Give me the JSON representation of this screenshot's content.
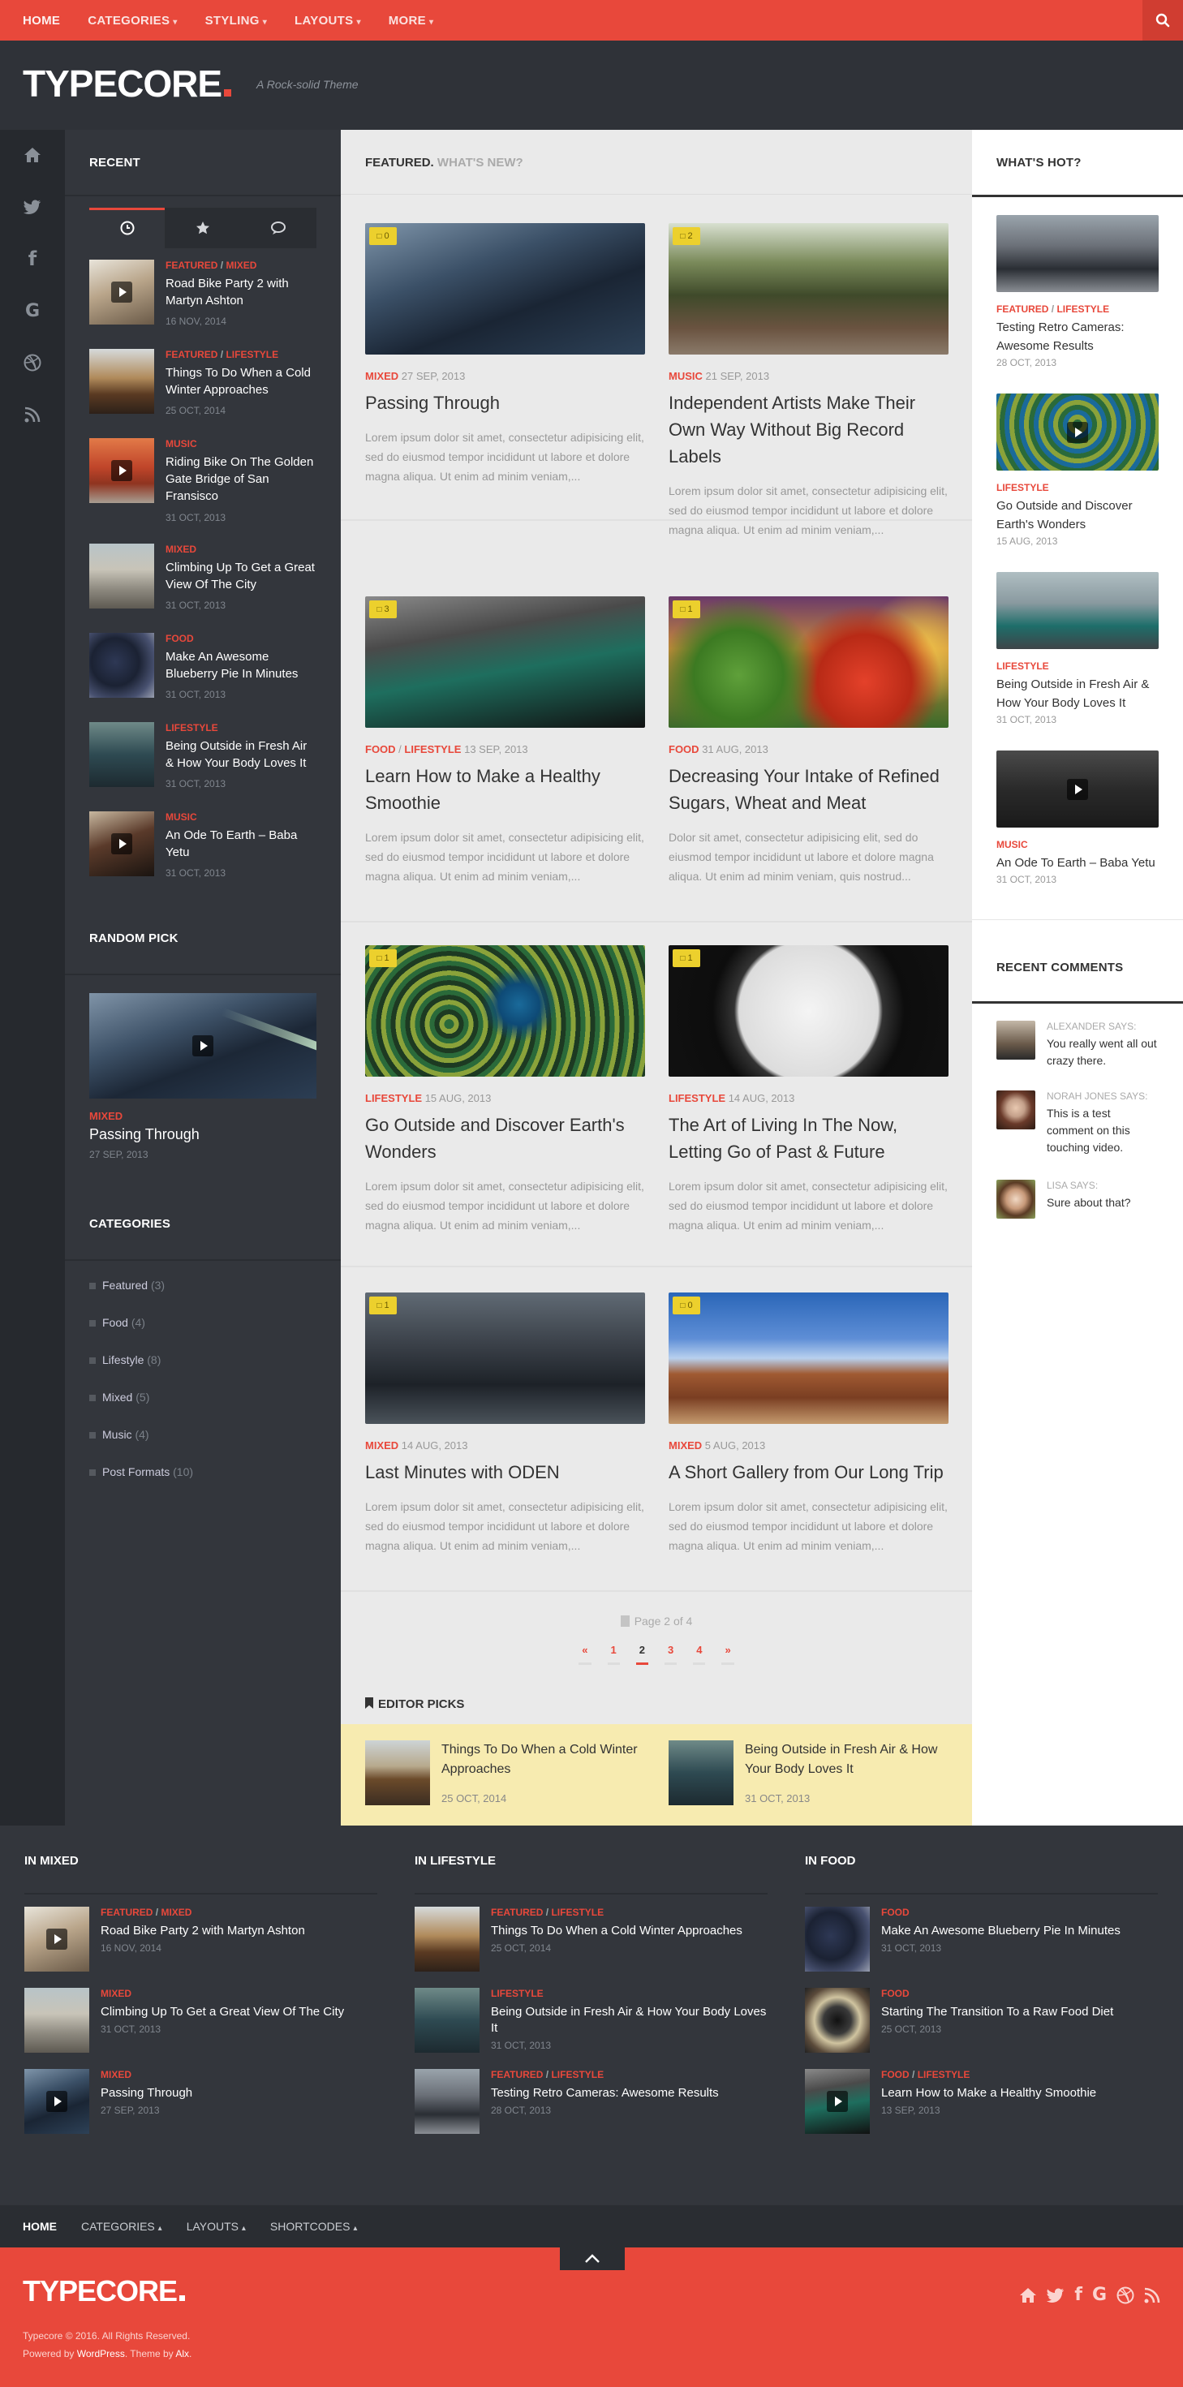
{
  "topnav": {
    "items": [
      {
        "label": "HOME",
        "caret": ""
      },
      {
        "label": "CATEGORIES",
        "caret": "▾"
      },
      {
        "label": "STYLING",
        "caret": "▾"
      },
      {
        "label": "LAYOUTS",
        "caret": "▾"
      },
      {
        "label": "MORE",
        "caret": "▾"
      }
    ],
    "search_icon": "search-icon",
    "accent": "#e8483b"
  },
  "header": {
    "logo": "TYPECORE",
    "tagline": "A Rock-solid Theme"
  },
  "iconbar": [
    "home-icon",
    "twitter-icon",
    "facebook-icon",
    "google-icon",
    "dribbble-icon",
    "rss-icon"
  ],
  "sidebar": {
    "recent_title": "RECENT",
    "tabs": [
      "clock-icon",
      "star-icon",
      "comments-icon"
    ],
    "recent": [
      {
        "cat1": "FEATURED",
        "cat2": "MIXED",
        "title": "Road Bike Party 2 with Martyn Ashton",
        "date": "16 NOV, 2014"
      },
      {
        "cat1": "FEATURED",
        "cat2": "LIFESTYLE",
        "title": "Things To Do When a Cold Winter Approaches",
        "date": "25 OCT, 2014"
      },
      {
        "cat1": "MUSIC",
        "cat2": "",
        "title": "Riding Bike On The Golden Gate Bridge of San Fransisco",
        "date": "31 OCT, 2013"
      },
      {
        "cat1": "MIXED",
        "cat2": "",
        "title": "Climbing Up To Get a Great View Of The City",
        "date": "31 OCT, 2013"
      },
      {
        "cat1": "FOOD",
        "cat2": "",
        "title": "Make An Awesome Blueberry Pie In Minutes",
        "date": "31 OCT, 2013"
      },
      {
        "cat1": "LIFESTYLE",
        "cat2": "",
        "title": "Being Outside in Fresh Air & How Your Body Loves It",
        "date": "31 OCT, 2013"
      },
      {
        "cat1": "MUSIC",
        "cat2": "",
        "title": "An Ode To Earth – Baba Yetu",
        "date": "31 OCT, 2013"
      }
    ],
    "random_title": "RANDOM PICK",
    "random": {
      "cat": "MIXED",
      "title": "Passing Through",
      "date": "27 SEP, 2013"
    },
    "categories_title": "CATEGORIES",
    "categories": [
      {
        "name": "Featured",
        "count": "(3)"
      },
      {
        "name": "Food",
        "count": "(4)"
      },
      {
        "name": "Lifestyle",
        "count": "(8)"
      },
      {
        "name": "Mixed",
        "count": "(5)"
      },
      {
        "name": "Music",
        "count": "(4)"
      },
      {
        "name": "Post Formats",
        "count": "(10)"
      }
    ]
  },
  "main": {
    "heading": "FEATURED.",
    "subheading": "WHAT'S NEW?",
    "posts": [
      {
        "comments": "0",
        "cat1": "MIXED",
        "cat2": "",
        "date": "27 SEP, 2013",
        "title": "Passing Through",
        "excerpt": "Lorem ipsum dolor sit amet, consectetur adipisicing elit, sed do eiusmod tempor incididunt ut labore et dolore magna aliqua. Ut enim ad minim veniam,..."
      },
      {
        "comments": "2",
        "cat1": "MUSIC",
        "cat2": "",
        "date": "21 SEP, 2013",
        "title": "Independent Artists Make Their Own Way Without Big Record Labels",
        "excerpt": "Lorem ipsum dolor sit amet, consectetur adipisicing elit, sed do eiusmod tempor incididunt ut labore et dolore magna aliqua. Ut enim ad minim veniam,..."
      },
      {
        "comments": "3",
        "cat1": "FOOD",
        "cat2": "LIFESTYLE",
        "date": "13 SEP, 2013",
        "title": "Learn How to Make a Healthy Smoothie",
        "excerpt": "Lorem ipsum dolor sit amet, consectetur adipisicing elit, sed do eiusmod tempor incididunt ut labore et dolore magna aliqua. Ut enim ad minim veniam,..."
      },
      {
        "comments": "1",
        "cat1": "FOOD",
        "cat2": "",
        "date": "31 AUG, 2013",
        "title": "Decreasing Your Intake of Refined Sugars, Wheat and Meat",
        "excerpt": "Dolor sit amet, consectetur adipisicing elit, sed do eiusmod tempor incididunt ut labore et dolore magna aliqua. Ut enim ad minim veniam, quis nostrud..."
      },
      {
        "comments": "1",
        "cat1": "LIFESTYLE",
        "cat2": "",
        "date": "15 AUG, 2013",
        "title": "Go Outside and Discover Earth's Wonders",
        "excerpt": "Lorem ipsum dolor sit amet, consectetur adipisicing elit, sed do eiusmod tempor incididunt ut labore et dolore magna aliqua. Ut enim ad minim veniam,..."
      },
      {
        "comments": "1",
        "cat1": "LIFESTYLE",
        "cat2": "",
        "date": "14 AUG, 2013",
        "title": "The Art of Living In The Now, Letting Go of Past & Future",
        "excerpt": "Lorem ipsum dolor sit amet, consectetur adipisicing elit, sed do eiusmod tempor incididunt ut labore et dolore magna aliqua. Ut enim ad minim veniam,..."
      },
      {
        "comments": "1",
        "cat1": "MIXED",
        "cat2": "",
        "date": "14 AUG, 2013",
        "title": "Last Minutes with ODEN",
        "excerpt": "Lorem ipsum dolor sit amet, consectetur adipisicing elit, sed do eiusmod tempor incididunt ut labore et dolore magna aliqua. Ut enim ad minim veniam,..."
      },
      {
        "comments": "0",
        "cat1": "MIXED",
        "cat2": "",
        "date": "5 AUG, 2013",
        "title": "A Short Gallery from Our Long Trip",
        "excerpt": "Lorem ipsum dolor sit amet, consectetur adipisicing elit, sed do eiusmod tempor incididunt ut labore et dolore magna aliqua. Ut enim ad minim veniam,..."
      }
    ],
    "page_info": "Page 2 of 4",
    "pages": [
      "«",
      "1",
      "2",
      "3",
      "4",
      "»"
    ],
    "current_page": "2",
    "editor_title": "EDITOR PICKS",
    "editor_picks": [
      {
        "title": "Things To Do When a Cold Winter Approaches",
        "date": "25 OCT, 2014"
      },
      {
        "title": "Being Outside in Fresh Air & How Your Body Loves It",
        "date": "31 OCT, 2013"
      }
    ]
  },
  "right": {
    "hot_title": "WHAT'S HOT?",
    "hot": [
      {
        "cat1": "FEATURED",
        "cat2": "LIFESTYLE",
        "title": "Testing Retro Cameras: Awesome Results",
        "date": "28 OCT, 2013"
      },
      {
        "cat1": "LIFESTYLE",
        "cat2": "",
        "title": "Go Outside and Discover Earth's Wonders",
        "date": "15 AUG, 2013"
      },
      {
        "cat1": "LIFESTYLE",
        "cat2": "",
        "title": "Being Outside in Fresh Air & How Your Body Loves It",
        "date": "31 OCT, 2013"
      },
      {
        "cat1": "MUSIC",
        "cat2": "",
        "title": "An Ode To Earth – Baba Yetu",
        "date": "31 OCT, 2013"
      }
    ],
    "comments_title": "RECENT COMMENTS",
    "comments": [
      {
        "name": "ALEXANDER SAYS:",
        "text": "You really went all out crazy there."
      },
      {
        "name": "NORAH JONES SAYS:",
        "text": "This is a test comment on this touching video."
      },
      {
        "name": "LISA SAYS:",
        "text": "Sure about that?"
      }
    ]
  },
  "footer_widgets": [
    {
      "title": "IN MIXED",
      "items": [
        {
          "cat1": "FEATURED",
          "cat2": "MIXED",
          "title": "Road Bike Party 2 with Martyn Ashton",
          "date": "16 NOV, 2014"
        },
        {
          "cat1": "MIXED",
          "cat2": "",
          "title": "Climbing Up To Get a Great View Of The City",
          "date": "31 OCT, 2013"
        },
        {
          "cat1": "MIXED",
          "cat2": "",
          "title": "Passing Through",
          "date": "27 SEP, 2013"
        }
      ]
    },
    {
      "title": "IN LIFESTYLE",
      "items": [
        {
          "cat1": "FEATURED",
          "cat2": "LIFESTYLE",
          "title": "Things To Do When a Cold Winter Approaches",
          "date": "25 OCT, 2014"
        },
        {
          "cat1": "LIFESTYLE",
          "cat2": "",
          "title": "Being Outside in Fresh Air & How Your Body Loves It",
          "date": "31 OCT, 2013"
        },
        {
          "cat1": "FEATURED",
          "cat2": "LIFESTYLE",
          "title": "Testing Retro Cameras: Awesome Results",
          "date": "28 OCT, 2013"
        }
      ]
    },
    {
      "title": "IN FOOD",
      "items": [
        {
          "cat1": "FOOD",
          "cat2": "",
          "title": "Make An Awesome Blueberry Pie In Minutes",
          "date": "31 OCT, 2013"
        },
        {
          "cat1": "FOOD",
          "cat2": "",
          "title": "Starting The Transition To a Raw Food Diet",
          "date": "25 OCT, 2013"
        },
        {
          "cat1": "FOOD",
          "cat2": "LIFESTYLE",
          "title": "Learn How to Make a Healthy Smoothie",
          "date": "13 SEP, 2013"
        }
      ]
    }
  ],
  "footer_nav": [
    {
      "label": "HOME",
      "caret": ""
    },
    {
      "label": "CATEGORIES",
      "caret": "▴"
    },
    {
      "label": "LAYOUTS",
      "caret": "▴"
    },
    {
      "label": "SHORTCODES",
      "caret": "▴"
    }
  ],
  "footer": {
    "logo": "TYPECORE",
    "copyright": "Typecore © 2016. All Rights Reserved.",
    "powered_pre": "Powered by",
    "powered_wp": "WordPress",
    "powered_mid": ". Theme by",
    "powered_alx": "Alx",
    "powered_end": ".",
    "social": [
      "home-icon",
      "twitter-icon",
      "facebook-icon",
      "google-icon",
      "dribbble-icon",
      "rss-icon"
    ]
  }
}
